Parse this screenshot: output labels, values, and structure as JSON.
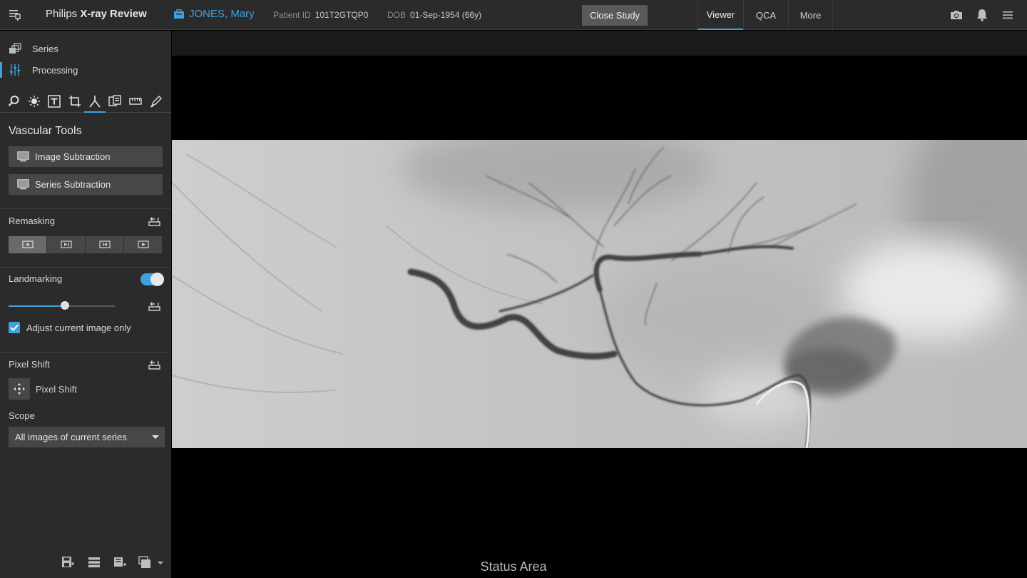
{
  "app": {
    "brand": "Philips",
    "product": "X-ray Review"
  },
  "patient": {
    "name": "JONES, Mary",
    "id_label": "Patient ID",
    "id_value": "101T2GTQP0",
    "dob_label": "DOB",
    "dob_value": "01-Sep-1954 (66y)"
  },
  "header": {
    "close_label": "Close Study",
    "tabs": [
      {
        "label": "Viewer",
        "active": true
      },
      {
        "label": "QCA",
        "active": false
      },
      {
        "label": "More",
        "active": false
      }
    ],
    "icons": [
      "camera-icon",
      "bell-icon",
      "hamburger-menu-icon"
    ]
  },
  "sidebar": {
    "nav": [
      {
        "label": "Series",
        "icon": "stack-icon",
        "active": false
      },
      {
        "label": "Processing",
        "icon": "sliders-icon",
        "active": true
      }
    ],
    "tools": [
      "magnifier-icon",
      "brightness-icon",
      "text-icon",
      "crop-icon",
      "vascular-icon",
      "subtract-icon",
      "ruler-icon",
      "pen-icon"
    ],
    "vascular": {
      "title": "Vascular Tools",
      "image_subtraction": "Image Subtraction",
      "series_subtraction": "Series Subtraction"
    },
    "remasking": {
      "label": "Remasking",
      "selected_index": 0
    },
    "landmarking": {
      "label": "Landmarking",
      "enabled": true,
      "level": 0.53
    },
    "adjust_current": {
      "label": "Adjust current image only",
      "checked": true
    },
    "pixel_shift": {
      "title": "Pixel Shift",
      "button_label": "Pixel Shift"
    },
    "scope": {
      "label": "Scope",
      "value": "All images of current series"
    },
    "bottom_icons": [
      "save-icon",
      "list-icon",
      "save-series-icon",
      "export-icon"
    ]
  },
  "viewer": {
    "status": "Status Area"
  },
  "colors": {
    "accent": "#3ea2e0",
    "panel": "#2b2b2b",
    "button": "#474747"
  }
}
